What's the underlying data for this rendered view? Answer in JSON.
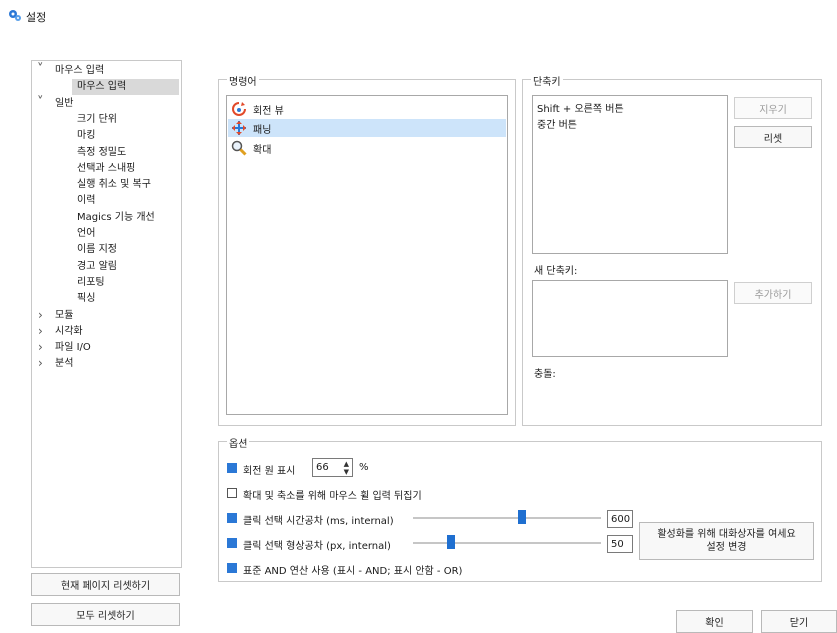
{
  "window": {
    "title": "설정",
    "icon": "gears-icon"
  },
  "tree": {
    "items": [
      {
        "label": "마우스 입력",
        "expanded": true,
        "level": 0
      },
      {
        "label": "마우스 입력",
        "level": 1,
        "selected": true
      },
      {
        "label": "일반",
        "expanded": true,
        "level": 0
      },
      {
        "label": "크기 단위",
        "level": 1
      },
      {
        "label": "마킹",
        "level": 1
      },
      {
        "label": "측정 정밀도",
        "level": 1
      },
      {
        "label": "선택과 스내핑",
        "level": 1
      },
      {
        "label": "실행 취소 및 복구",
        "level": 1
      },
      {
        "label": "이력",
        "level": 1
      },
      {
        "label": "Magics 기능 개선",
        "level": 1
      },
      {
        "label": "언어",
        "level": 1
      },
      {
        "label": "이름 지정",
        "level": 1
      },
      {
        "label": "경고 알림",
        "level": 1
      },
      {
        "label": "리포팅",
        "level": 1
      },
      {
        "label": "픽싱",
        "level": 1
      },
      {
        "label": "모듈",
        "expanded": false,
        "level": 0
      },
      {
        "label": "시각화",
        "expanded": false,
        "level": 0
      },
      {
        "label": "파일 I/O",
        "expanded": false,
        "level": 0
      },
      {
        "label": "분석",
        "expanded": false,
        "level": 0
      }
    ],
    "reset_page": "현재 페이지 리셋하기",
    "reset_all": "모두 리셋하기"
  },
  "commands": {
    "title": "명령어",
    "items": [
      {
        "label": "회전 뷰",
        "icon": "rotate-view-icon"
      },
      {
        "label": "패닝",
        "icon": "pan-icon",
        "selected": true
      },
      {
        "label": "확대",
        "icon": "zoom-icon"
      }
    ]
  },
  "shortcuts": {
    "title": "단축키",
    "items": [
      "Shift + 오른쪽 버튼",
      "중간 버튼"
    ],
    "delete": "지우기",
    "reset": "리셋",
    "new_label": "새 단축키:",
    "add": "추가하기",
    "conflict_label": "충돌:"
  },
  "options": {
    "title": "옵션",
    "rotation_center": {
      "label": "회전 원 표시",
      "checked": true,
      "value": "66",
      "unit": "%"
    },
    "invert_wheel": {
      "label": "확대 및 축소를 위해 마우스 휠 입력 뒤집기",
      "checked": false
    },
    "click_time": {
      "label": "클릭 선택 시간공차 (ms, internal)",
      "checked": true,
      "value": "600",
      "level": 0.58
    },
    "click_shape": {
      "label": "클릭 선택 형상공차 (px, internal)",
      "checked": true,
      "value": "50",
      "level": 0.2
    },
    "and_op": {
      "label": "표준 AND 연산 사용 (표시 - AND; 표시 안함 - OR)",
      "checked": true
    },
    "dialog_button": "활성화를 위해 대화상자를 여세요\n설정 변경"
  },
  "footer": {
    "ok": "확인",
    "close": "닫기"
  },
  "colors": {
    "accent": "#2b78d6",
    "selection": "#cde4fa",
    "tree_selection": "#d9d9d9"
  }
}
